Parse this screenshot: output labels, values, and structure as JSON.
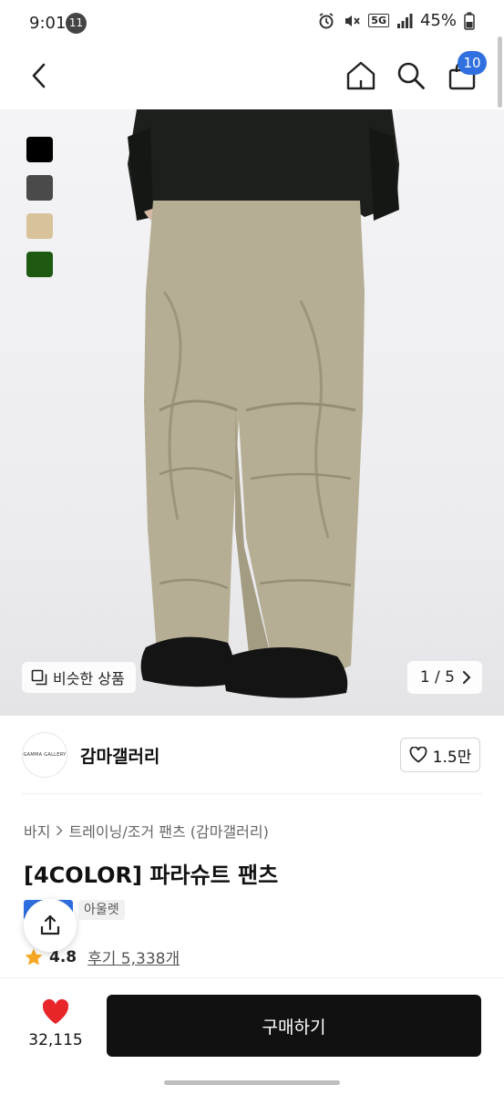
{
  "status_bar": {
    "time": "9:01",
    "notification_count": "11",
    "network": "5G",
    "battery": "45%"
  },
  "nav": {
    "cart_count": "10"
  },
  "gallery": {
    "swatches": [
      {
        "color": "#000000"
      },
      {
        "color": "#4a4a4a"
      },
      {
        "color": "#d8c29a"
      },
      {
        "color": "#1f5a12"
      }
    ],
    "similar_label": "비슷한 상품",
    "pager_text": "1 / 5"
  },
  "brand": {
    "logo_text": "GAMMA GALLERY",
    "name": "감마갤러리",
    "like_count": "1.5만"
  },
  "product": {
    "breadcrumb": [
      "바지",
      "트레이닝/조거 팬츠 (감마갤러리)"
    ],
    "title": "[4COLOR] 파라슈트 팬츠",
    "badge_outlet": "아울렛",
    "rating": "4.8",
    "reviews": "후기 5,338개"
  },
  "bottom_bar": {
    "wish_count": "32,115",
    "buy_label": "구매하기"
  },
  "colors": {
    "accent": "#2f6fe0",
    "heart": "#e8262a",
    "star": "#f5a623"
  }
}
